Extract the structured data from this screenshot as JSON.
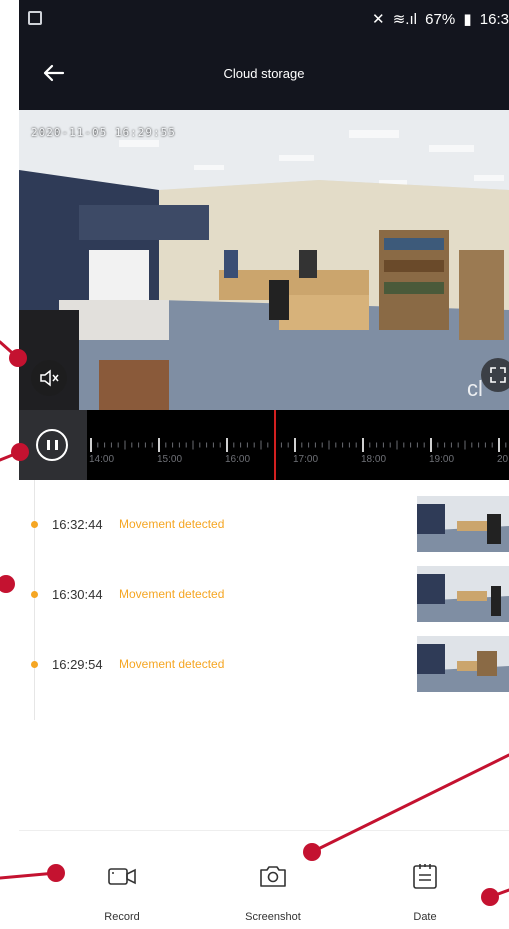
{
  "status_bar": {
    "battery": "67%",
    "time": "16:3"
  },
  "app_bar": {
    "title": "Cloud storage"
  },
  "video": {
    "timestamp": "2020-11-05 16:29:55",
    "watermark": "cl"
  },
  "timeline": {
    "labels": [
      "14:00",
      "15:00",
      "16:00",
      "17:00",
      "18:00",
      "19:00",
      "20"
    ]
  },
  "events": [
    {
      "time": "16:32:44",
      "desc": "Movement detected"
    },
    {
      "time": "16:30:44",
      "desc": "Movement detected"
    },
    {
      "time": "16:29:54",
      "desc": "Movement detected"
    }
  ],
  "bottom_bar": {
    "record": "Record",
    "screenshot": "Screenshot",
    "date": "Date"
  },
  "colors": {
    "accent": "#f5a623",
    "header_bg": "#13151e",
    "timeline_cursor": "#d22020",
    "annotation": "#c41230"
  }
}
